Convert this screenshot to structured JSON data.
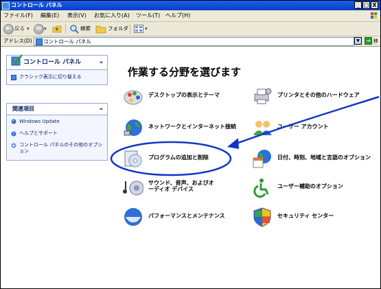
{
  "window": {
    "title": "コントロール パネル",
    "minimize_glyph": "_",
    "maximize_glyph": "□",
    "close_glyph": "X"
  },
  "menu": {
    "items": [
      "ファイル(F)",
      "編集(E)",
      "表示(V)",
      "お気に入り(A)",
      "ツール(T)",
      "ヘルプ(H)"
    ]
  },
  "toolbar": {
    "back_label": "戻る",
    "back_glyph": "←",
    "forward_glyph": "→",
    "search_label": "検索",
    "folders_label": "フォルダ"
  },
  "address": {
    "label": "アドレス(D)",
    "value": "コントロール パネル",
    "go_label": "移動",
    "go_glyph": "→"
  },
  "sidebar": {
    "control_panel": {
      "title": "コントロール パネル",
      "chevron": "«",
      "link": "クラシック表示に切り替える"
    },
    "related": {
      "title": "関連項目",
      "chevron": "«",
      "links": [
        {
          "label": "Windows Update",
          "icon": "windows-update-icon"
        },
        {
          "label": "ヘルプとサポート",
          "icon": "help-icon"
        },
        {
          "label": "コントロール パネルのその他のオプション",
          "icon": "options-icon"
        }
      ]
    }
  },
  "main": {
    "title": "作業する分野を選びます",
    "categories": [
      {
        "label": "デスクトップの表示とテーマ",
        "icon": "desktop-theme-icon"
      },
      {
        "label": "プリンタとその他のハードウェア",
        "icon": "printer-hardware-icon"
      },
      {
        "label": "ネットワークとインターネット接続",
        "icon": "network-internet-icon"
      },
      {
        "label": "ユーザー アカウント",
        "icon": "user-accounts-icon"
      },
      {
        "label": "プログラムの追加と削除",
        "icon": "add-remove-programs-icon"
      },
      {
        "label": "日付、時刻、地域と言語のオプション",
        "icon": "date-time-language-icon"
      },
      {
        "label": "サウンド、音声、およびオーディオ デバイス",
        "icon": "sounds-audio-icon"
      },
      {
        "label": "ユーザー補助のオプション",
        "icon": "accessibility-icon"
      },
      {
        "label": "パフォーマンスとメンテナンス",
        "icon": "performance-maintenance-icon"
      },
      {
        "label": "セキュリティ センター",
        "icon": "security-center-icon"
      }
    ]
  },
  "annotation": {
    "highlighted_item": "プログラムの追加と削除",
    "color": "#1033c8"
  },
  "colors": {
    "titlebar": "#0a3fc9",
    "chrome": "#ece9d8",
    "panel_header_text": "#0a246a"
  }
}
